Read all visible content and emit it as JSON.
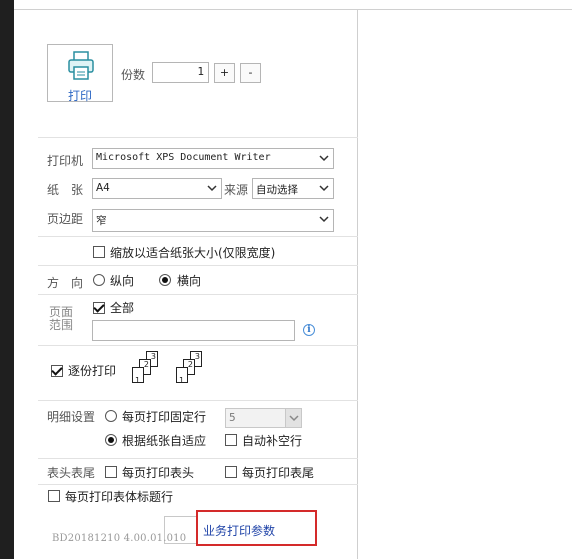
{
  "print_button": {
    "label": "打印",
    "icon": "printer-icon"
  },
  "copies": {
    "label": "份数",
    "value": "1",
    "plus": "+",
    "minus": "-"
  },
  "printer": {
    "label": "打印机",
    "value": "Microsoft XPS Document Writer"
  },
  "paper": {
    "label": "纸　张",
    "value": "A4",
    "source_label": "来源",
    "source_value": "自动选择"
  },
  "margin": {
    "label": "页边距",
    "value": "窄"
  },
  "fit_paper": {
    "label": "缩放以适合纸张大小(仅限宽度)",
    "checked": false
  },
  "orientation": {
    "label": "方　向",
    "options": [
      "纵向",
      "横向"
    ],
    "selected": "横向"
  },
  "page_range": {
    "label_line1": "页面",
    "label_line2": "范围",
    "all_label": "全部",
    "all_checked": true,
    "input_value": "",
    "info_icon": "info-icon"
  },
  "collate": {
    "label": "逐份打印",
    "checked": true,
    "stack1": [
      "3",
      "2",
      "1"
    ],
    "stack2": [
      "3",
      "2",
      "1"
    ]
  },
  "detail": {
    "label": "明细设置",
    "fixed_rows_label": "每页打印固定行",
    "fixed_rows_value": "5",
    "auto_fit_label": "根据纸张自适应",
    "auto_fill_label": "自动补空行",
    "selected": "根据纸张自适应",
    "auto_fill_checked": false
  },
  "header_footer": {
    "label": "表头表尾",
    "print_header_label": "每页打印表头",
    "print_footer_label": "每页打印表尾",
    "print_header_checked": false,
    "print_footer_checked": false
  },
  "table_title": {
    "label": "每页打印表体标题行",
    "checked": false
  },
  "version": "BD20181210 4.00.01.010",
  "business_button": {
    "label": "业务打印参数"
  }
}
